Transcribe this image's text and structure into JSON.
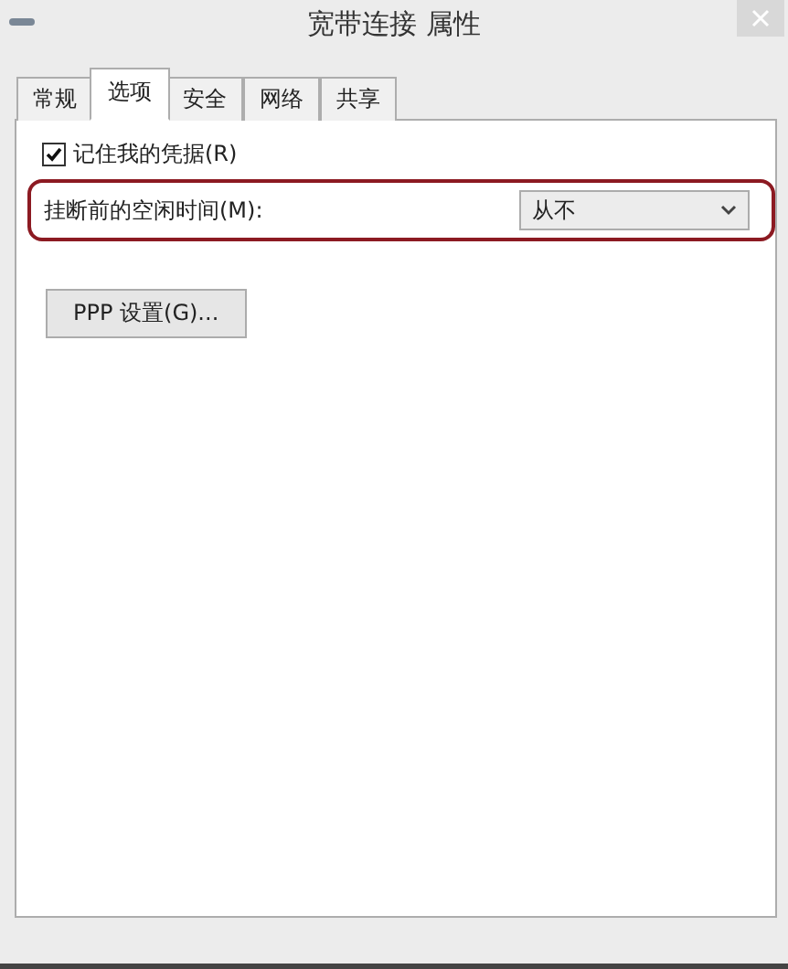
{
  "window": {
    "title": "宽带连接 属性"
  },
  "tabs": [
    {
      "label": "常规",
      "selected": false
    },
    {
      "label": "选项",
      "selected": true
    },
    {
      "label": "安全",
      "selected": false
    },
    {
      "label": "网络",
      "selected": false
    },
    {
      "label": "共享",
      "selected": false
    }
  ],
  "remember_credentials": {
    "label": "记住我的凭据(R)",
    "checked": true
  },
  "idle_time": {
    "label": "挂断前的空闲时间(M):",
    "value": "从不",
    "highlighted": true
  },
  "buttons": [
    {
      "label": "PPP 设置(G)..."
    }
  ]
}
